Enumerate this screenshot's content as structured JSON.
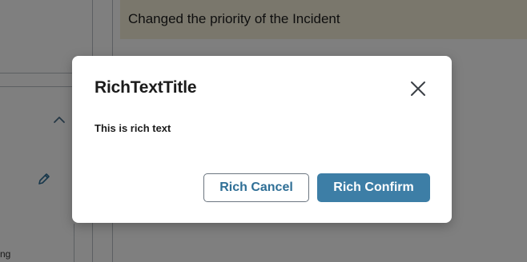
{
  "background": {
    "activity_text": "Changed the priority of the Incident",
    "fragment_text": "ng",
    "icons": {
      "chevron": "chevron-up-icon",
      "edit": "pencil-icon"
    },
    "colors": {
      "activity_card": "#f4efd9"
    }
  },
  "modal": {
    "title": "RichTextTitle",
    "body": "This is rich text",
    "close_icon": "close-icon",
    "cancel_label": "Rich Cancel",
    "confirm_label": "Rich Confirm",
    "colors": {
      "confirm_bg": "#3d7ea6",
      "cancel_text": "#2f6f96",
      "overlay": "rgba(0,0,0,0.5)"
    }
  }
}
